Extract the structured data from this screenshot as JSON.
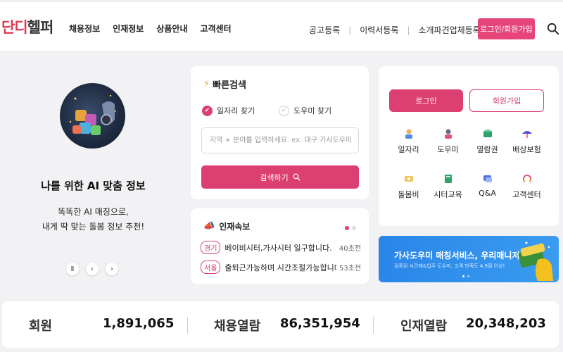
{
  "header": {
    "logo_part1": "단디",
    "logo_part2": "헬퍼",
    "nav_left": [
      "채용정보",
      "인재정보",
      "상품안내",
      "고객센터"
    ],
    "nav_right": [
      "공고등록",
      "이력서등록",
      "소개파견업체등록"
    ],
    "login_label": "로그인/회원가입"
  },
  "promo": {
    "title": "나를 위한 AI 맞춤 정보",
    "sub_line1": "똑똑한 AI 매칭으로,",
    "sub_line2": "내게 딱 맞는 돌봄 정보 추천!",
    "pause_icon": "pause-icon",
    "prev_icon": "chevron-left-icon",
    "next_icon": "chevron-right-icon"
  },
  "quick_search": {
    "title": "빠른검색",
    "option_job": "일자리 찾기",
    "option_helper": "도우미 찾기",
    "selected": "일자리 찾기",
    "placeholder": "지역 + 분야를 입력하세요. ex. 대구 가사도우미",
    "button_label": "검색하기"
  },
  "news": {
    "title": "인재속보",
    "items": [
      {
        "tag": "경기",
        "text": "베이비시터,가사시터 일구합니다.",
        "ago": "40초전"
      },
      {
        "tag": "서울",
        "text": "출퇴근가능하며 시간조절가능합니다.",
        "ago": "53초전"
      }
    ]
  },
  "account": {
    "login_label": "로그인",
    "join_label": "회원가입",
    "menu": [
      {
        "label": "일자리",
        "icon": "job-icon"
      },
      {
        "label": "도우미",
        "icon": "helper-icon"
      },
      {
        "label": "열람권",
        "icon": "ticket-icon"
      },
      {
        "label": "배상보험",
        "icon": "umbrella-icon"
      },
      {
        "label": "돌봄비",
        "icon": "care-fee-icon"
      },
      {
        "label": "시터교육",
        "icon": "book-icon"
      },
      {
        "label": "Q&A",
        "icon": "qa-icon"
      },
      {
        "label": "고객센터",
        "icon": "headset-icon"
      }
    ]
  },
  "banner": {
    "title": "가사도우미 매칭서비스, 우리매니저",
    "sub": "검증된 시간제&입주 도우미, 고객 만족도 4.9점 이상!"
  },
  "stats": [
    {
      "label": "회원",
      "value": "1,891,065"
    },
    {
      "label": "채용열람",
      "value": "86,351,954"
    },
    {
      "label": "인재열람",
      "value": "20,348,203"
    }
  ],
  "colors": {
    "accent": "#dc3f71",
    "banner": "#2a86e8",
    "background": "#f2f2f4"
  }
}
